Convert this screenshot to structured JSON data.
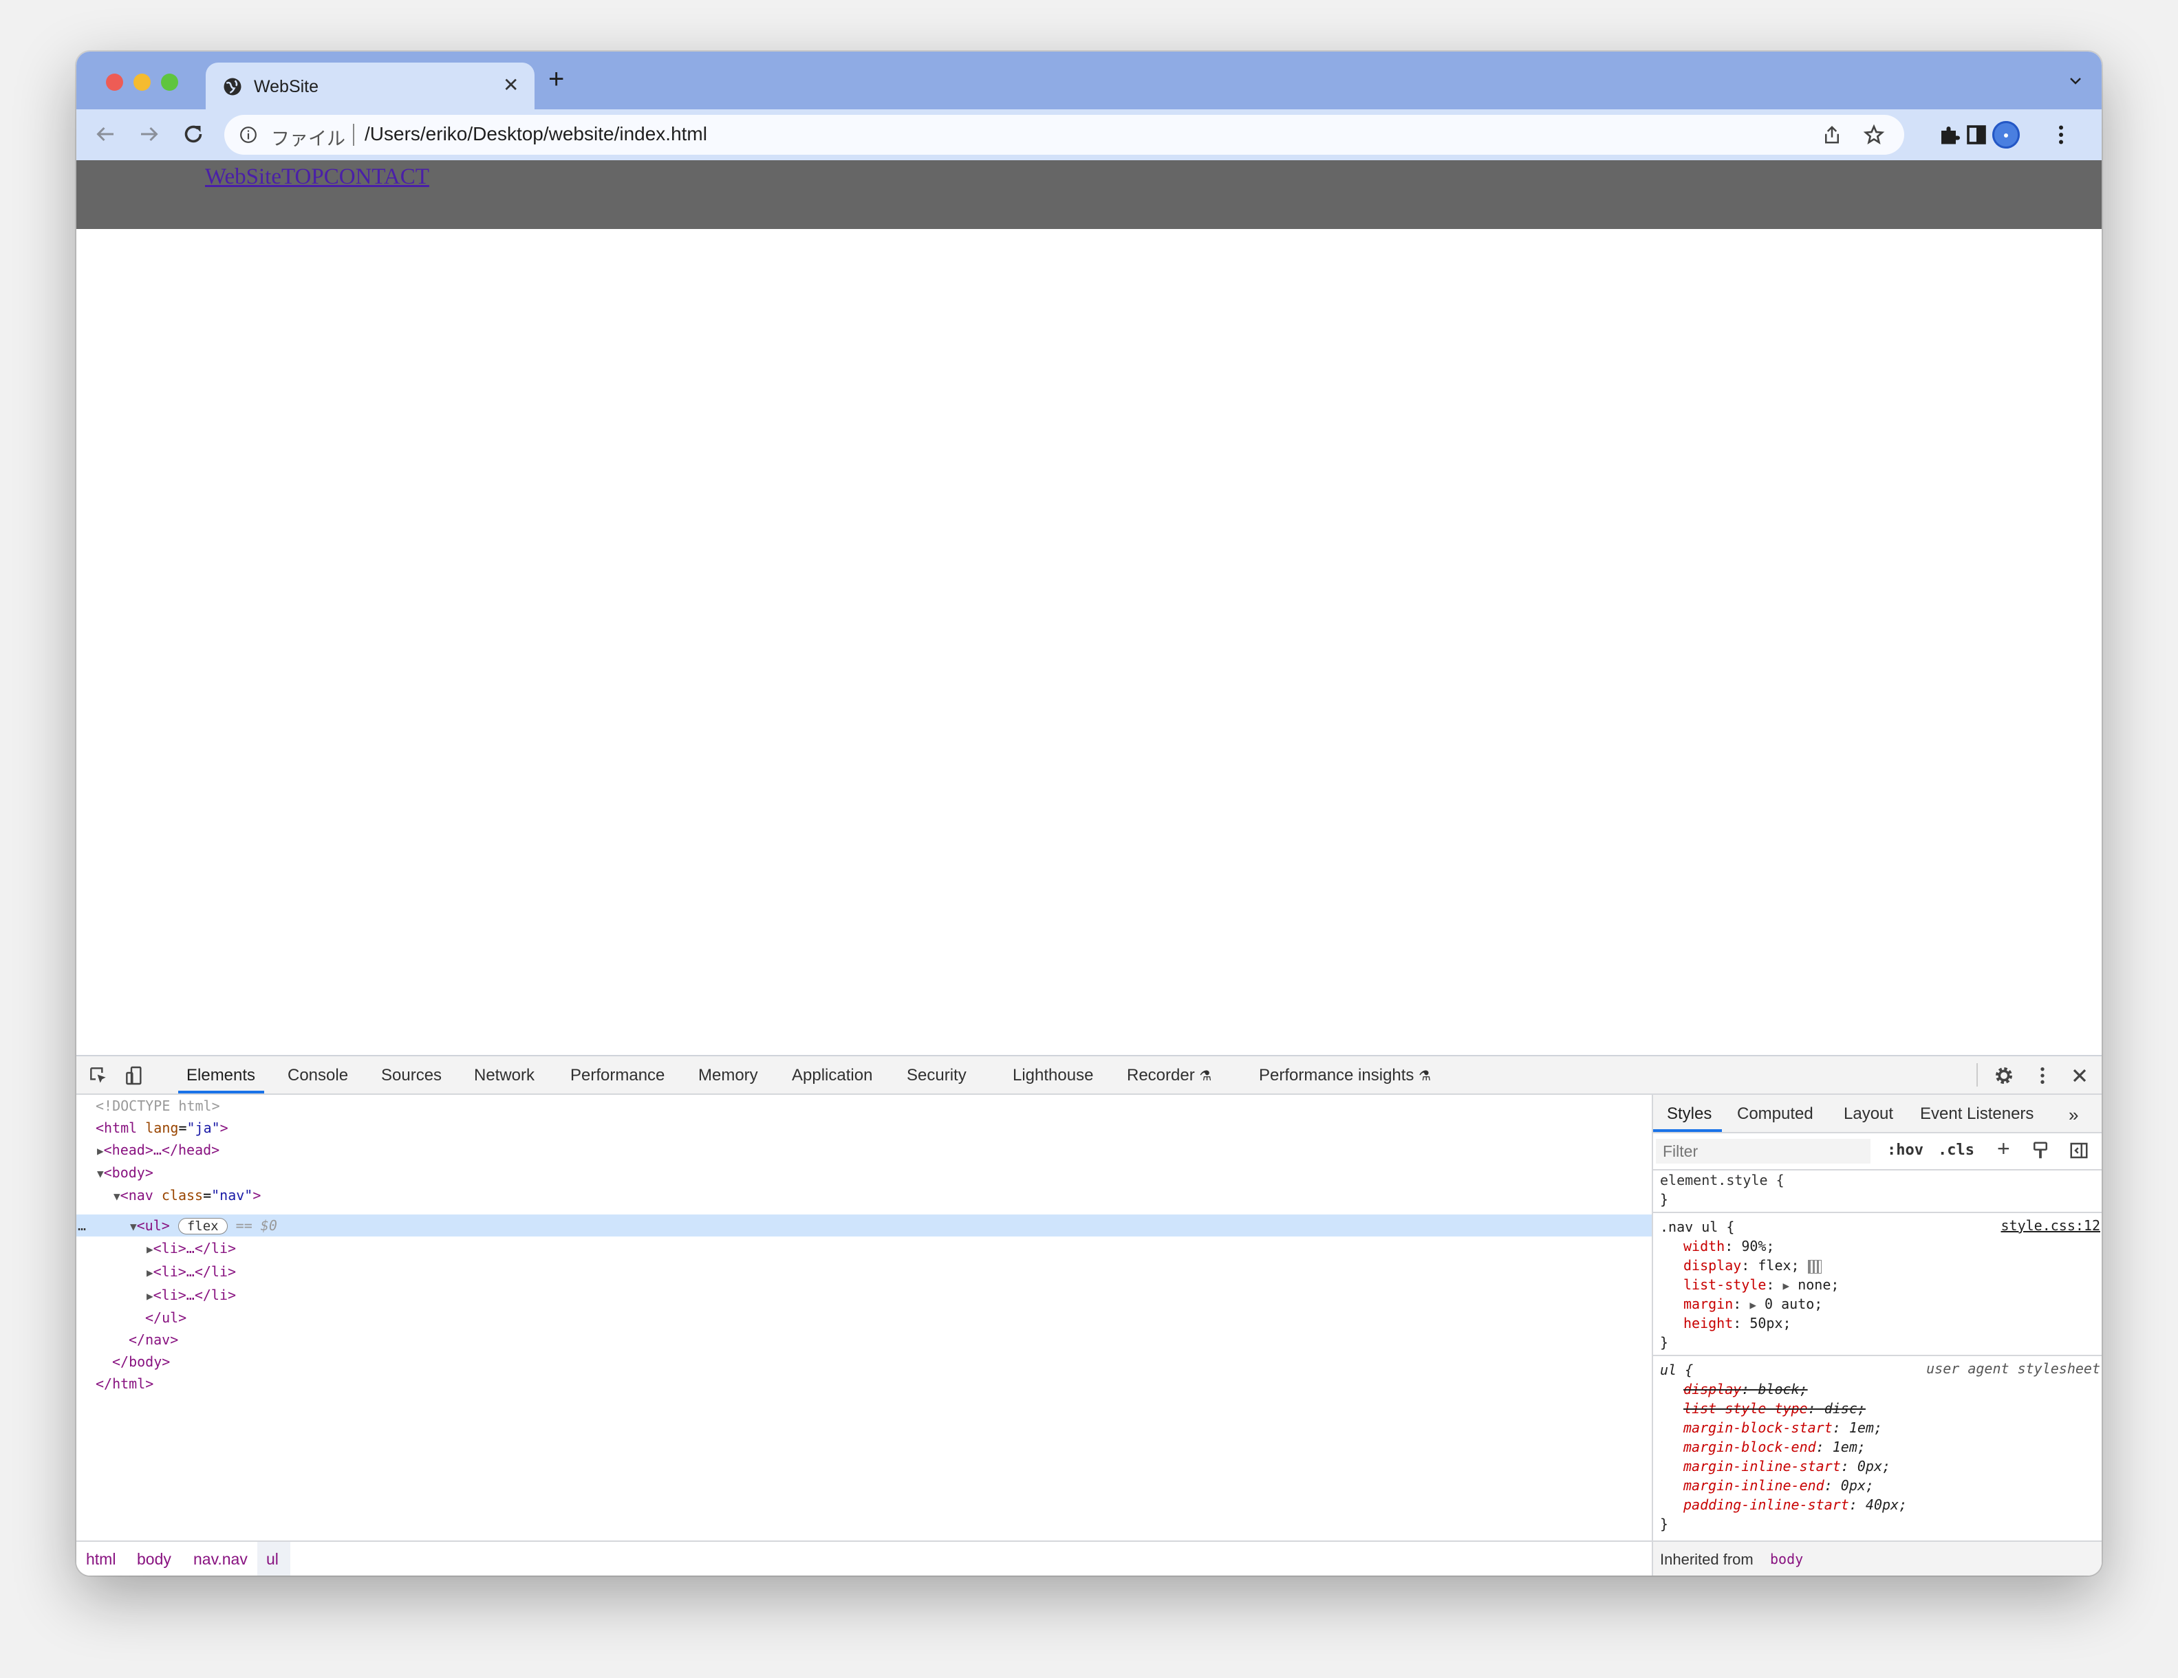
{
  "browser": {
    "tab_title": "WebSite",
    "address": {
      "scheme_label": "ファイル",
      "url": "/Users/eriko/Desktop/website/index.html"
    }
  },
  "page": {
    "nav_links": "WebSiteTOPCONTACT"
  },
  "devtools": {
    "tabs": [
      "Elements",
      "Console",
      "Sources",
      "Network",
      "Performance",
      "Memory",
      "Application",
      "Security",
      "Lighthouse",
      "Recorder",
      "Performance insights"
    ],
    "dom": {
      "doctype": "<!DOCTYPE html>",
      "html_tag": "html",
      "html_attr": "lang",
      "html_val": "\"ja\"",
      "head": "<head>…</head>",
      "body_open": "<body>",
      "nav_tag": "nav",
      "nav_attr": "class",
      "nav_val": "\"nav\"",
      "ul_open": "<ul>",
      "flex_badge": "flex",
      "dollar": "== $0",
      "li": "<li>…</li>",
      "ul_close": "</ul>",
      "nav_close": "</nav>",
      "body_close": "</body>",
      "html_close": "</html>",
      "ellipsis": "…"
    },
    "breadcrumbs": [
      "html",
      "body",
      "nav.nav",
      "ul"
    ],
    "styles": {
      "tabs": [
        "Styles",
        "Computed",
        "Layout",
        "Event Listeners"
      ],
      "filter_placeholder": "Filter",
      "hov": ":hov",
      "cls": ".cls",
      "element_style": "element.style {",
      "close_brace": "}",
      "rule1_selector": ".nav ul {",
      "rule1_source": "style.css:12",
      "rule1": [
        {
          "prop": "width",
          "value": "90%;"
        },
        {
          "prop": "display",
          "value": "flex;"
        },
        {
          "prop": "list-style",
          "value": "none;"
        },
        {
          "prop": "margin",
          "value": "0 auto;"
        },
        {
          "prop": "height",
          "value": "50px;"
        }
      ],
      "rule2_selector": "ul {",
      "rule2_source": "user agent stylesheet",
      "rule2": [
        {
          "prop": "display",
          "value": "block;"
        },
        {
          "prop": "list-style-type",
          "value": "disc;"
        },
        {
          "prop": "margin-block-start",
          "value": "1em;"
        },
        {
          "prop": "margin-block-end",
          "value": "1em;"
        },
        {
          "prop": "margin-inline-start",
          "value": "0px;"
        },
        {
          "prop": "margin-inline-end",
          "value": "0px;"
        },
        {
          "prop": "padding-inline-start",
          "value": "40px;"
        }
      ],
      "inherited_label": "Inherited from",
      "inherited_from": "body"
    }
  }
}
